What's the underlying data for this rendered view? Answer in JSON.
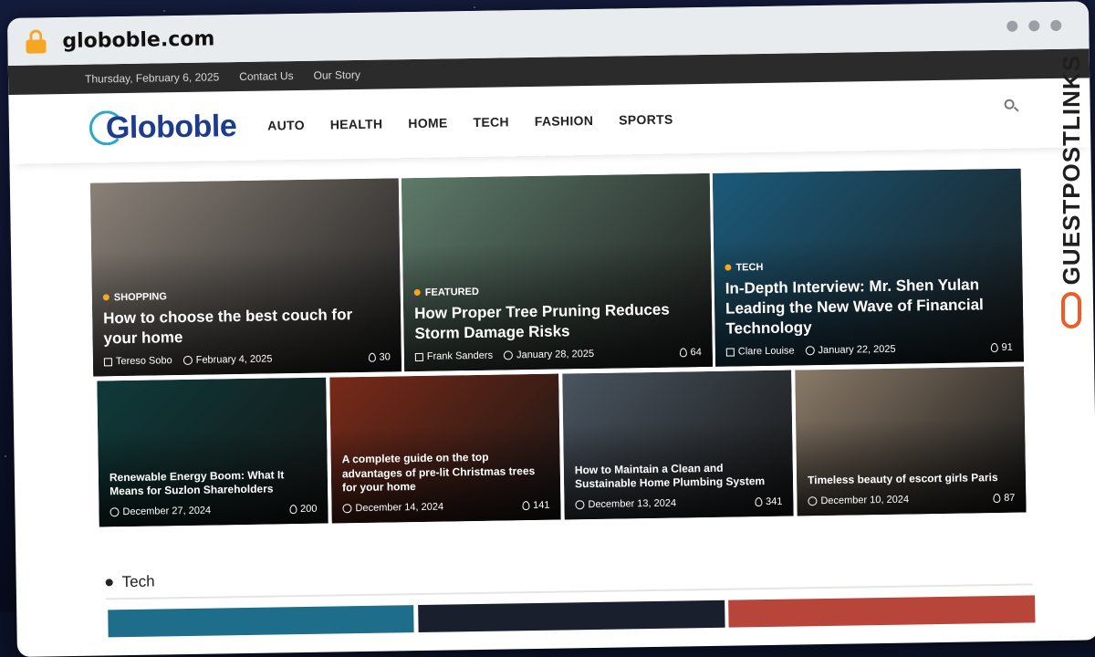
{
  "browser": {
    "url": "globoble.com"
  },
  "topbar": {
    "date": "Thursday, February 6, 2025",
    "links": [
      "Contact Us",
      "Our Story"
    ]
  },
  "header": {
    "logo": "Globoble",
    "nav": [
      "AUTO",
      "HEALTH",
      "HOME",
      "TECH",
      "FASHION",
      "SPORTS"
    ]
  },
  "featured": [
    {
      "tag": "SHOPPING",
      "title": "How to choose the best couch for your home",
      "author": "Tereso Sobo",
      "date": "February 4, 2025",
      "views": "30",
      "color": "#8a8178"
    },
    {
      "tag": "FEATURED",
      "title": "How Proper Tree Pruning Reduces Storm Damage Risks",
      "author": "Frank Sanders",
      "date": "January 28, 2025",
      "views": "64",
      "color": "#5d7a6a"
    },
    {
      "tag": "TECH",
      "title": "In-Depth Interview: Mr. Shen Yulan Leading the New Wave of Financial Technology",
      "author": "Clare Louise",
      "date": "January 22, 2025",
      "views": "91",
      "color": "#1b5a7a"
    }
  ],
  "latest": [
    {
      "title": "Renewable Energy Boom: What It Means for Suzlon Shareholders",
      "date": "December 27, 2024",
      "views": "200",
      "color": "#0f3a3a"
    },
    {
      "title": "A complete guide on the top advantages of pre-lit Christmas trees for your home",
      "date": "December 14, 2024",
      "views": "141",
      "color": "#7a2a18"
    },
    {
      "title": "How to Maintain a Clean and Sustainable Home Plumbing System",
      "date": "December 13, 2024",
      "views": "341",
      "color": "#4a5560"
    },
    {
      "title": "Timeless beauty of escort girls Paris",
      "date": "December 10, 2024",
      "views": "87",
      "color": "#8a7a68"
    }
  ],
  "section": {
    "title": "Tech"
  },
  "watermark": {
    "text": "GUESTPOSTLINKS"
  }
}
